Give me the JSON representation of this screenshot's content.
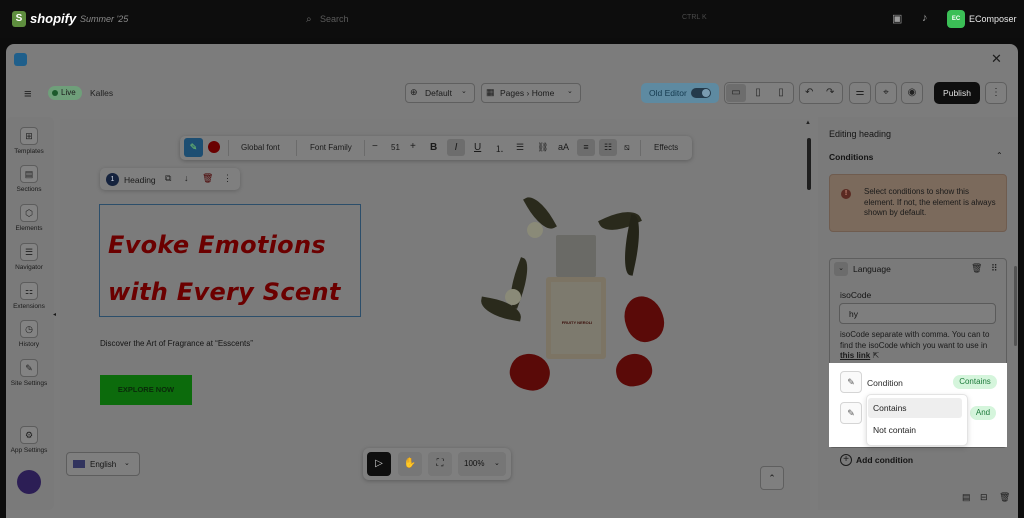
{
  "shopify": {
    "logo_letter": "S",
    "brand": "shopify",
    "edition": "Summer '25",
    "search_placeholder": "Search",
    "search_shortcut": "CTRL  K",
    "account_initials": "EC",
    "account_name": "EComposer"
  },
  "editor_header": {
    "close": "✕",
    "status": "Live",
    "theme": "Kalles",
    "template_select": "Default",
    "page_select": "Pages",
    "page_current": "Home",
    "old_editor_label": "Old Editor",
    "publish_label": "Publish"
  },
  "left_sidebar": {
    "items": [
      {
        "label": "Templates",
        "icon": "templates-icon",
        "glyph": "⊞"
      },
      {
        "label": "Sections",
        "icon": "sections-icon",
        "glyph": "▤"
      },
      {
        "label": "Elements",
        "icon": "elements-icon",
        "glyph": "⬡"
      },
      {
        "label": "Navigator",
        "icon": "navigator-icon",
        "glyph": "☰"
      },
      {
        "label": "Extensions",
        "icon": "extensions-icon",
        "glyph": "⚏"
      },
      {
        "label": "History",
        "icon": "history-icon",
        "glyph": "◷"
      },
      {
        "label": "Site Settings",
        "icon": "site-settings-icon",
        "glyph": "✎"
      },
      {
        "label": "App Settings",
        "icon": "app-settings-icon",
        "glyph": "⚙"
      }
    ]
  },
  "text_toolbar": {
    "global_font": "Global font",
    "font_family": "Font Family",
    "decrease": "−",
    "font_size": "51",
    "increase": "+",
    "bold": "B",
    "italic": "I",
    "underline": "U",
    "case": "aA",
    "effects": "Effects"
  },
  "heading_toolbar": {
    "index": "1",
    "label": "Heading"
  },
  "hero": {
    "heading_line1": "Evoke Emotions",
    "heading_line2": "with Every Scent",
    "subtext": "Discover the Art of Fragrance at “Esscents”",
    "cta": "EXPLORE NOW",
    "bottle_label": "FRUITY NEROLI"
  },
  "canvas_footer": {
    "language": "English",
    "zoom": "100%"
  },
  "right_panel": {
    "title": "Editing heading",
    "section": "Conditions",
    "info": "Select conditions to show this element. If not, the element is always shown by default.",
    "card_title": "Language",
    "iso_label": "isoCode",
    "iso_value": "hy",
    "iso_help": "isoCode separate with comma. You can to find the isoCode which you want to use in",
    "iso_link": "this link",
    "condition_label": "Condition",
    "condition_badge": "Contains",
    "and_badge": "And",
    "dropdown_options": [
      "Contains",
      "Not contain"
    ],
    "add_condition": "Add condition"
  },
  "colors": {
    "live_green": "#6f9f7a",
    "publish_bg": "#0e0e0e",
    "badge_green": "#d5f5dc",
    "info_bg": "#7b6a5c"
  }
}
